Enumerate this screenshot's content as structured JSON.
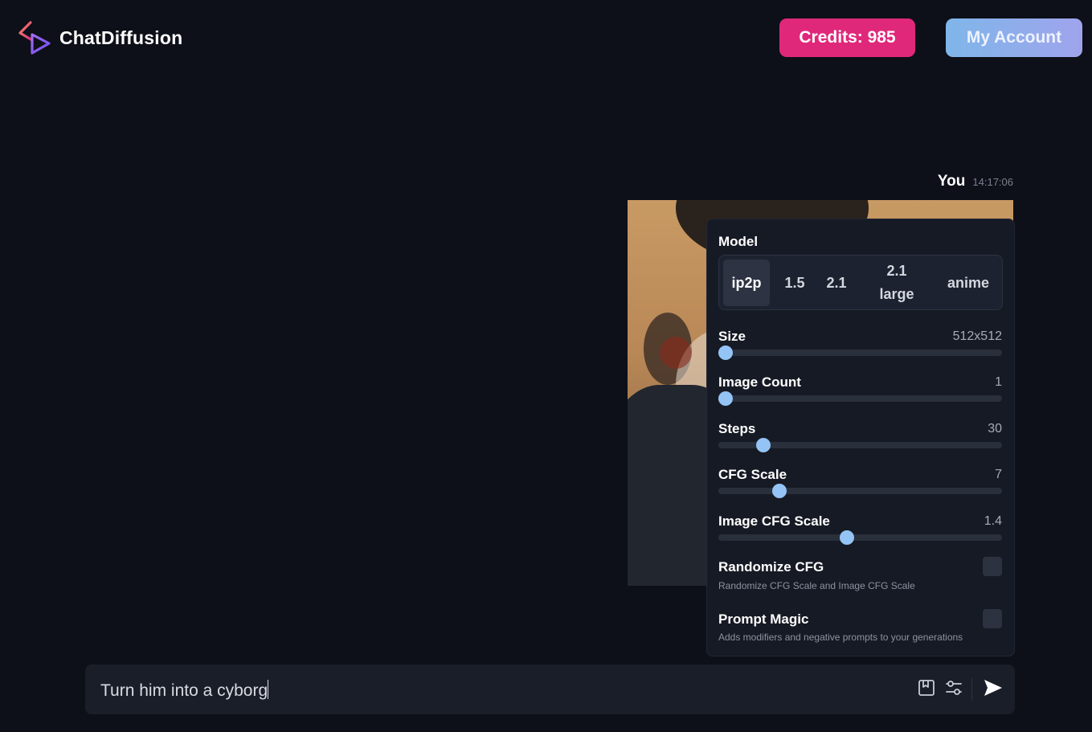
{
  "app": {
    "name": "ChatDiffusion"
  },
  "header": {
    "credits_label": "Credits: 985",
    "account_label": "My Account"
  },
  "message": {
    "author": "You",
    "time": "14:17:06"
  },
  "settings": {
    "model_label": "Model",
    "models": [
      "ip2p",
      "1.5",
      "2.1",
      "2.1 large",
      "anime"
    ],
    "selected_model": "ip2p",
    "size": {
      "label": "Size",
      "value": "512x512",
      "level": 0
    },
    "image_count": {
      "label": "Image Count",
      "value": "1",
      "level": 0
    },
    "steps": {
      "label": "Steps",
      "value": "30",
      "level": 0.14
    },
    "cfg_scale": {
      "label": "CFG Scale",
      "value": "7",
      "level": 0.2
    },
    "image_cfg_scale": {
      "label": "Image CFG Scale",
      "value": "1.4",
      "level": 0.45
    },
    "randomize_cfg": {
      "label": "Randomize CFG",
      "description": "Randomize CFG Scale and Image CFG Scale",
      "checked": false
    },
    "prompt_magic": {
      "label": "Prompt Magic",
      "description": "Adds modifiers and negative prompts to your generations",
      "checked": false
    }
  },
  "input": {
    "value": "Turn him into a cyborg"
  },
  "colors": {
    "background": "#0d1018",
    "credits": "#e0287a",
    "account_gradient": [
      "#7fb6ea",
      "#9fa4ec"
    ],
    "slider_thumb": "#93c4f5",
    "panel": "#161a24"
  },
  "icons": [
    "logo-icon",
    "bookmark-icon",
    "settings-sliders-icon",
    "send-icon"
  ]
}
